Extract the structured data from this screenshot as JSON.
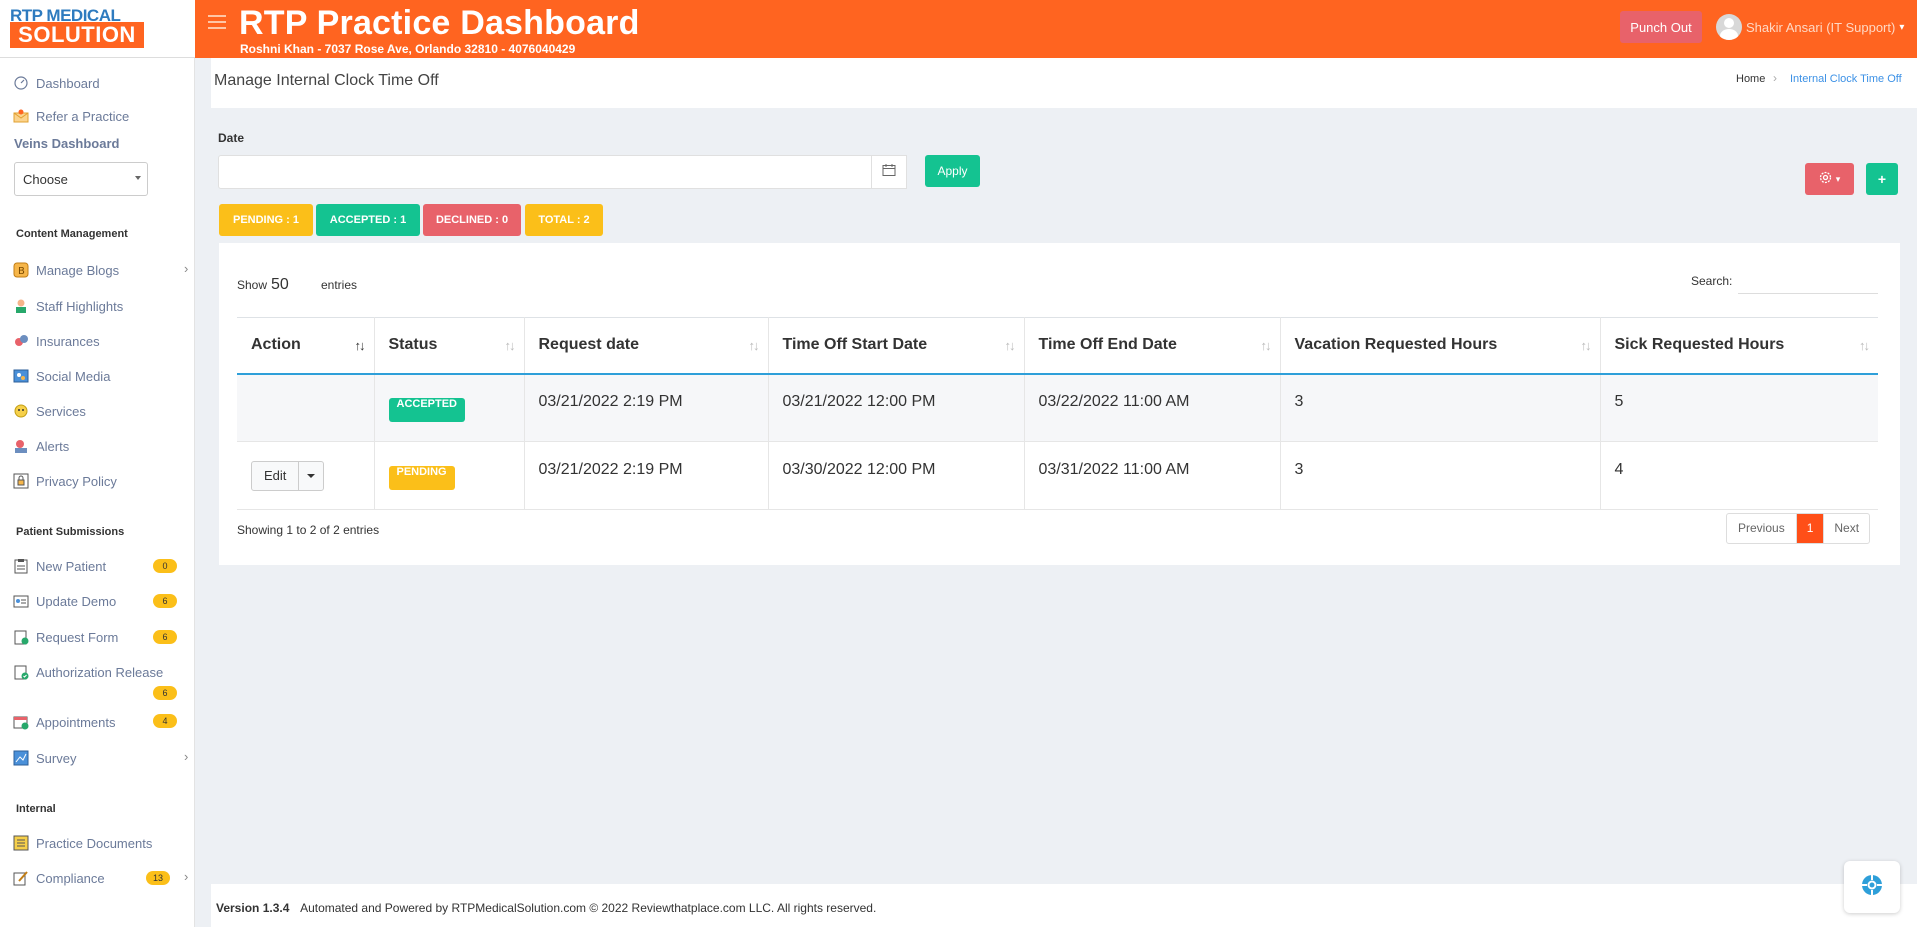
{
  "header": {
    "logo_top": "RTP MEDICAL",
    "logo_bottom": "SOLUTION",
    "title": "RTP Practice Dashboard",
    "subtitle": "Roshni Khan - 7037 Rose Ave, Orlando 32810 - 4076040429",
    "punch_label": "Punch Out",
    "user_name": "Shakir Ansari (IT Support)"
  },
  "sidebar": {
    "dashboard": "Dashboard",
    "refer": "Refer a Practice",
    "veins_label": "Veins Dashboard",
    "select_value": "Choose",
    "section_content": "Content Management",
    "content_items": [
      "Manage Blogs",
      "Staff Highlights",
      "Insurances",
      "Social Media",
      "Services",
      "Alerts",
      "Privacy Policy"
    ],
    "section_patient": "Patient Submissions",
    "patient_items": [
      {
        "label": "New Patient",
        "count": "0"
      },
      {
        "label": "Update Demo",
        "count": "6"
      },
      {
        "label": "Request Form",
        "count": "6"
      },
      {
        "label": "Authorization Release",
        "count": "6"
      },
      {
        "label": "Appointments",
        "count": "4"
      },
      {
        "label": "Survey",
        "count": ""
      }
    ],
    "section_internal": "Internal",
    "internal_items": [
      {
        "label": "Practice Documents",
        "count": ""
      },
      {
        "label": "Compliance",
        "count": "13"
      }
    ]
  },
  "page": {
    "title": "Manage Internal Clock Time Off",
    "breadcrumb_home": "Home",
    "breadcrumb_current": "Internal Clock Time Off"
  },
  "filter": {
    "date_label": "Date",
    "date_value": "",
    "apply_label": "Apply",
    "plus_label": "+"
  },
  "stats": {
    "pending": "PENDING : 1",
    "accepted": "ACCEPTED : 1",
    "declined": "DECLINED : 0",
    "total": "TOTAL : 2"
  },
  "table": {
    "show_label": "Show",
    "show_value": "50",
    "entries_label": "entries",
    "search_label": "Search:",
    "columns": [
      "Action",
      "Status",
      "Request date",
      "Time Off Start Date",
      "Time Off End Date",
      "Vacation Requested Hours",
      "Sick Requested Hours"
    ],
    "rows": [
      {
        "action": "",
        "status": "ACCEPTED",
        "request_date": "03/21/2022 2:19 PM",
        "start": "03/21/2022 12:00 PM",
        "end": "03/22/2022 11:00 AM",
        "vacation": "3",
        "sick": "5"
      },
      {
        "action": "Edit",
        "status": "PENDING",
        "request_date": "03/21/2022 2:19 PM",
        "start": "03/30/2022 12:00 PM",
        "end": "03/31/2022 11:00 AM",
        "vacation": "3",
        "sick": "4"
      }
    ],
    "showing": "Showing 1 to 2 of 2 entries",
    "pager": {
      "prev": "Previous",
      "current": "1",
      "next": "Next"
    }
  },
  "footer": {
    "version": "Version 1.3.4",
    "text": "Automated and Powered by RTPMedicalSolution.com © 2022 Reviewthatplace.com LLC. All rights reserved."
  },
  "colors": {
    "brand_orange": "#ff6420",
    "green": "#14c391",
    "red": "#e8626a",
    "yellow": "#fbbf19",
    "blue": "#2e9fd9"
  }
}
